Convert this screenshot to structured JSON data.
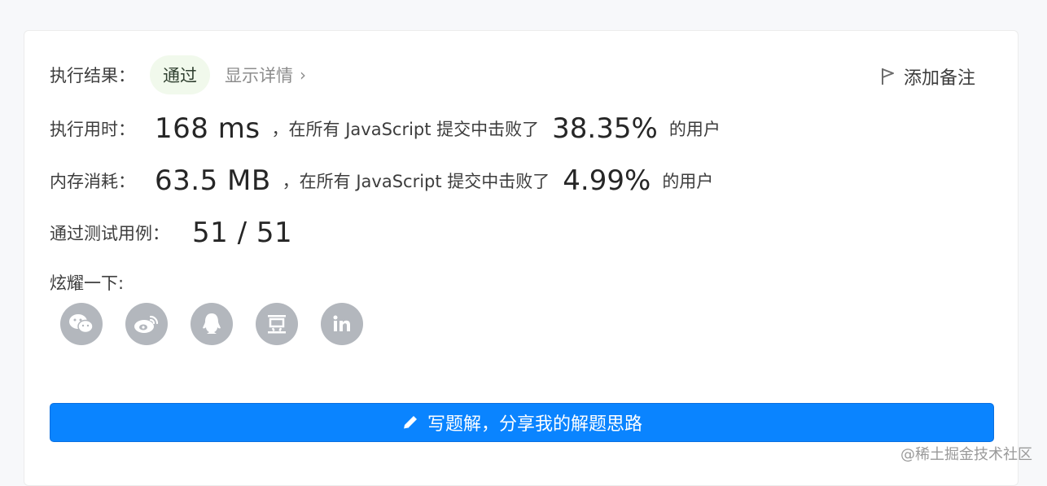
{
  "result": {
    "label": "执行结果：",
    "status": "通过",
    "details_link": "显示详情",
    "add_note": "添加备注"
  },
  "runtime": {
    "label": "执行用时：",
    "value": "168 ms",
    "middle": "，在所有 JavaScript 提交中击败了",
    "percent": "38.35%",
    "suffix": "的用户"
  },
  "memory": {
    "label": "内存消耗：",
    "value": "63.5 MB",
    "middle": "，在所有 JavaScript 提交中击败了",
    "percent": "4.99%",
    "suffix": "的用户"
  },
  "tests": {
    "label": "通过测试用例：",
    "value": "51 / 51"
  },
  "share": {
    "label": "炫耀一下:",
    "icons": [
      "wechat-icon",
      "weibo-icon",
      "qq-icon",
      "douban-icon",
      "linkedin-icon"
    ]
  },
  "cta": {
    "label": "写题解，分享我的解题思路"
  },
  "watermark": "@稀土掘金技术社区",
  "colors": {
    "accent": "#0a84ff",
    "badge_bg": "#f1f9ec",
    "icon_gray": "#b3b7bd"
  }
}
